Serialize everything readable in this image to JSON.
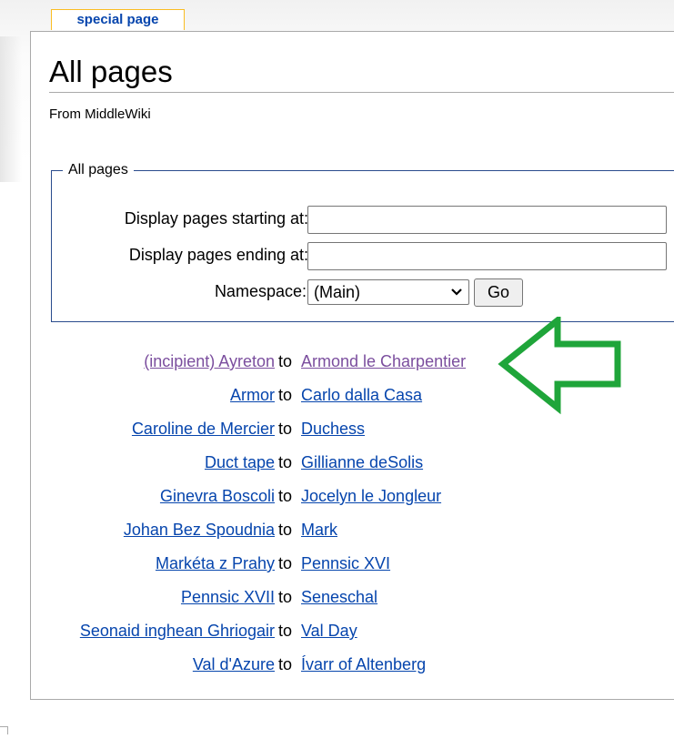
{
  "tabs": [
    {
      "label": "special page"
    }
  ],
  "page": {
    "title": "All pages",
    "subtitle": "From MiddleWiki"
  },
  "form": {
    "legend": "All pages",
    "start_label": "Display pages starting at:",
    "start_value": "",
    "end_label": "Display pages ending at:",
    "end_value": "",
    "namespace_label": "Namespace:",
    "namespace_value": "(Main)",
    "go_label": "Go"
  },
  "ranges": [
    {
      "from": "(incipient) Ayreton",
      "to_word": "to",
      "to": "Armond le Charpentier",
      "visited": true
    },
    {
      "from": "Armor",
      "to_word": "to",
      "to": "Carlo dalla Casa",
      "visited": false
    },
    {
      "from": "Caroline de Mercier",
      "to_word": "to",
      "to": "Duchess",
      "visited": false
    },
    {
      "from": "Duct tape",
      "to_word": "to",
      "to": "Gillianne deSolis",
      "visited": false
    },
    {
      "from": "Ginevra Boscoli",
      "to_word": "to",
      "to": "Jocelyn le Jongleur",
      "visited": false
    },
    {
      "from": "Johan Bez Spoudnia",
      "to_word": "to",
      "to": "Mark",
      "visited": false
    },
    {
      "from": "Markéta z Prahy",
      "to_word": "to",
      "to": "Pennsic XVI",
      "visited": false
    },
    {
      "from": "Pennsic XVII",
      "to_word": "to",
      "to": "Seneschal",
      "visited": false
    },
    {
      "from": "Seonaid inghean Ghriogair",
      "to_word": "to",
      "to": "Val Day",
      "visited": false
    },
    {
      "from": "Val d'Azure",
      "to_word": "to",
      "to": "Ívarr of Altenberg",
      "visited": false
    }
  ],
  "colors": {
    "link": "#0645ad",
    "visited_link": "#7b4e9e",
    "tab_border": "#fabd23",
    "fieldset_border": "#2a4b8d",
    "annotation_arrow": "#1fa53a"
  },
  "icons": {
    "annotation": "arrow-left-icon",
    "select": "chevron-down-icon"
  }
}
